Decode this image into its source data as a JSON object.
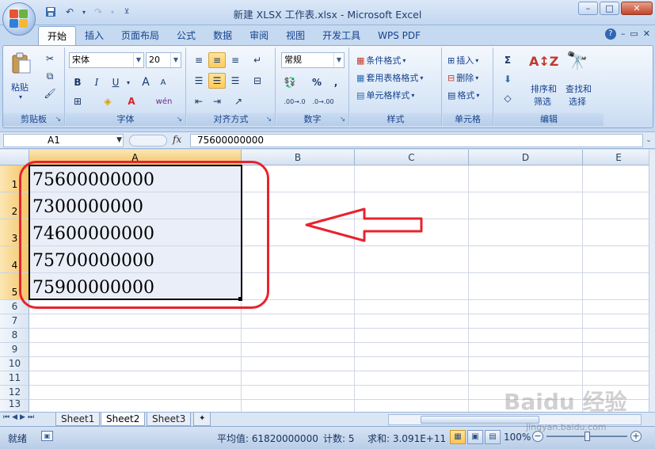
{
  "window": {
    "title": "新建 XLSX 工作表.xlsx - Microsoft Excel",
    "min": "–",
    "max": "□",
    "close": "✕"
  },
  "tabs": [
    {
      "label": "开始",
      "active": true
    },
    {
      "label": "插入"
    },
    {
      "label": "页面布局"
    },
    {
      "label": "公式"
    },
    {
      "label": "数据"
    },
    {
      "label": "审阅"
    },
    {
      "label": "视图"
    },
    {
      "label": "开发工具"
    },
    {
      "label": "WPS PDF"
    }
  ],
  "ribbon": {
    "clipboard": {
      "label": "剪贴板",
      "paste": "粘贴"
    },
    "font": {
      "label": "字体",
      "name": "宋体",
      "size": "20",
      "bold": "B",
      "italic": "I",
      "underline": "U",
      "grow": "A",
      "shrink": "A",
      "phonetic": "wén"
    },
    "alignment": {
      "label": "对齐方式"
    },
    "number": {
      "label": "数字",
      "format": "常规",
      "percent": "%",
      "comma": ",",
      "inc_decimal": ".00→.0",
      "dec_decimal": ".0→.00"
    },
    "styles": {
      "label": "样式",
      "conditional": "条件格式",
      "table": "套用表格格式",
      "cell_styles": "单元格样式"
    },
    "cells": {
      "label": "单元格",
      "insert": "插入",
      "delete": "删除",
      "format": "格式"
    },
    "editing": {
      "label": "编辑",
      "sort": "排序和",
      "sort2": "筛选",
      "find": "查找和",
      "find2": "选择"
    }
  },
  "formula_bar": {
    "name_box": "A1",
    "fx": "fx",
    "value": "75600000000"
  },
  "grid": {
    "columns": [
      "A",
      "B",
      "C",
      "D",
      "E"
    ],
    "rows": [
      "1",
      "2",
      "3",
      "4",
      "5",
      "6",
      "7",
      "8",
      "9",
      "10",
      "11",
      "12",
      "13"
    ],
    "cells": [
      "75600000000",
      "7300000000",
      "74600000000",
      "75700000000",
      "75900000000"
    ]
  },
  "sheets": [
    {
      "name": "Sheet1"
    },
    {
      "name": "Sheet2",
      "active": true
    },
    {
      "name": "Sheet3"
    }
  ],
  "status": {
    "ready": "就绪",
    "average": "平均值: 61820000000",
    "count": "计数: 5",
    "sum": "求和: 3.091E+11",
    "zoom": "100%"
  },
  "watermark": {
    "brand": "Baidu 经验",
    "url": "jingyan.baidu.com"
  },
  "colors": {
    "annotation": "#e8232e",
    "selection": "#eaeef8",
    "header_selected": "#f5c467"
  }
}
